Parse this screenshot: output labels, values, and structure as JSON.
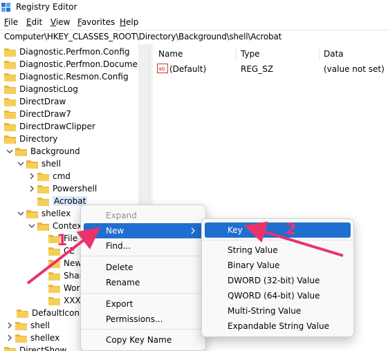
{
  "window": {
    "title": "Registry Editor"
  },
  "menubar": [
    {
      "first": "F",
      "rest": "ile"
    },
    {
      "first": "E",
      "rest": "dit"
    },
    {
      "first": "V",
      "rest": "iew"
    },
    {
      "first": "F",
      "rest": "avorites"
    },
    {
      "first": "H",
      "rest": "elp"
    }
  ],
  "address": "Computer\\HKEY_CLASSES_ROOT\\Directory\\Background\\shell\\Acrobat",
  "tree": [
    {
      "label": "Diagnostic.Perfmon.Config"
    },
    {
      "label": "Diagnostic.Perfmon.Document"
    },
    {
      "label": "Diagnostic.Resmon.Config"
    },
    {
      "label": "DiagnosticLog"
    },
    {
      "label": "DirectDraw"
    },
    {
      "label": "DirectDraw7"
    },
    {
      "label": "DirectDrawClipper"
    },
    {
      "label": "Directory"
    },
    {
      "label": "Background"
    },
    {
      "label": "shell"
    },
    {
      "label": "cmd"
    },
    {
      "label": "Powershell"
    },
    {
      "label": "Acrobat"
    },
    {
      "label": "shellex"
    },
    {
      "label": "Contex"
    },
    {
      "label": "File"
    },
    {
      "label": "CE"
    },
    {
      "label": "New"
    },
    {
      "label": "Shar"
    },
    {
      "label": "Wor"
    },
    {
      "label": "XXX"
    },
    {
      "label": "DefaultIcon"
    },
    {
      "label": "shell"
    },
    {
      "label": "shellex"
    },
    {
      "label": "DirectShow"
    }
  ],
  "values_pane": {
    "columns": [
      "Name",
      "Type",
      "Data"
    ],
    "rows": [
      {
        "name": "(Default)",
        "type": "REG_SZ",
        "data": "(value not set)"
      }
    ]
  },
  "context_menu": {
    "items": [
      "Expand",
      "New",
      "Find...",
      "Delete",
      "Rename",
      "Export",
      "Permissions...",
      "Copy Key Name"
    ]
  },
  "submenu": {
    "items": [
      "Key",
      "String Value",
      "Binary Value",
      "DWORD (32-bit) Value",
      "QWORD (64-bit) Value",
      "Multi-String Value",
      "Expandable String Value"
    ]
  },
  "annotations": {
    "one": "1",
    "two": "2",
    "color": "#e8336d"
  },
  "colors": {
    "folder": "#f2c94c",
    "highlight": "#1f6fd0",
    "selection": "#d9e8fb"
  }
}
